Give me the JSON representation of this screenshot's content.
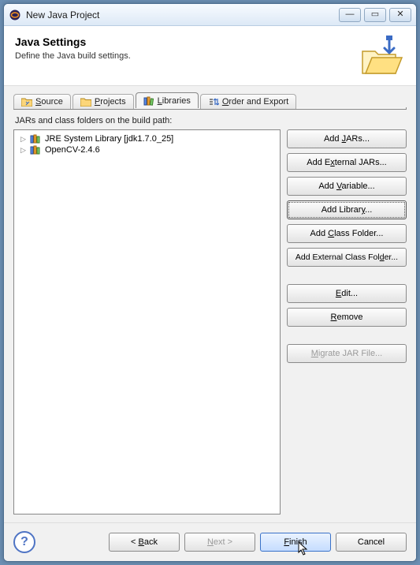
{
  "window": {
    "title": "New Java Project"
  },
  "header": {
    "title": "Java Settings",
    "subtitle": "Define the Java build settings."
  },
  "tabs": [
    {
      "label": "Source"
    },
    {
      "label": "Projects"
    },
    {
      "label": "Libraries"
    },
    {
      "label": "Order and Export"
    }
  ],
  "section_label": "JARs and class folders on the build path:",
  "tree": [
    {
      "label": "JRE System Library [jdk1.7.0_25]"
    },
    {
      "label": "OpenCV-2.4.6"
    }
  ],
  "side_buttons": {
    "add_jars": "Add JARs...",
    "add_external_jars": "Add External JARs...",
    "add_variable": "Add Variable...",
    "add_library": "Add Library...",
    "add_class_folder": "Add Class Folder...",
    "add_external_class_folder": "Add External Class Folder...",
    "edit": "Edit...",
    "remove": "Remove",
    "migrate": "Migrate JAR File..."
  },
  "footer": {
    "back": "< Back",
    "next": "Next >",
    "finish": "Finish",
    "cancel": "Cancel"
  }
}
